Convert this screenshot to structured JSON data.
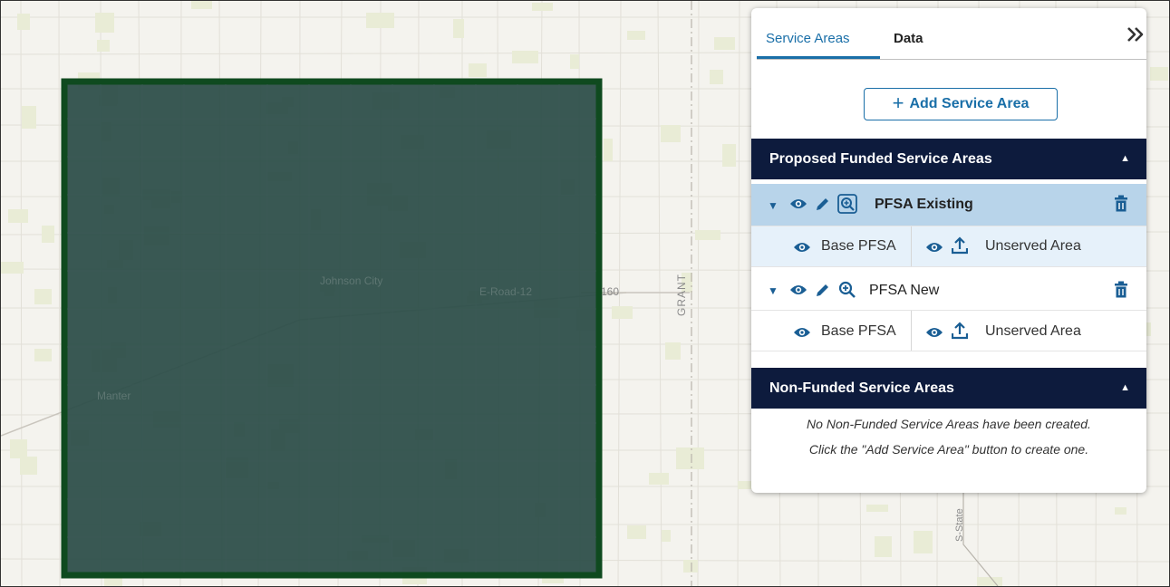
{
  "map": {
    "labels": [
      "Johnson City",
      "E-Road-12",
      "160",
      "GRANT",
      "Manter",
      "S-State"
    ]
  },
  "panel": {
    "tabs": [
      {
        "label": "Service Areas",
        "active": true
      },
      {
        "label": "Data",
        "active": false
      }
    ],
    "collapse_icon": "double-chevron-right-icon",
    "add_button_label": "Add Service Area",
    "funded": {
      "title": "Proposed Funded Service Areas",
      "items": [
        {
          "name": "PFSA Existing",
          "selected": true,
          "base_label": "Base PFSA",
          "unserved_label": "Unserved Area"
        },
        {
          "name": "PFSA New",
          "selected": false,
          "base_label": "Base PFSA",
          "unserved_label": "Unserved Area"
        }
      ]
    },
    "non_funded": {
      "title": "Non-Funded Service Areas",
      "empty_line1": "No Non-Funded Service Areas have been created.",
      "empty_line2": "Click the \"Add Service Area\" button to create one."
    }
  },
  "colors": {
    "accent": "#1a6fa8",
    "header_bg": "#0d1b3d",
    "selected_row": "#b8d4ea",
    "polygon_fill": "#2e4f4a",
    "polygon_border": "#0f4a1f"
  }
}
